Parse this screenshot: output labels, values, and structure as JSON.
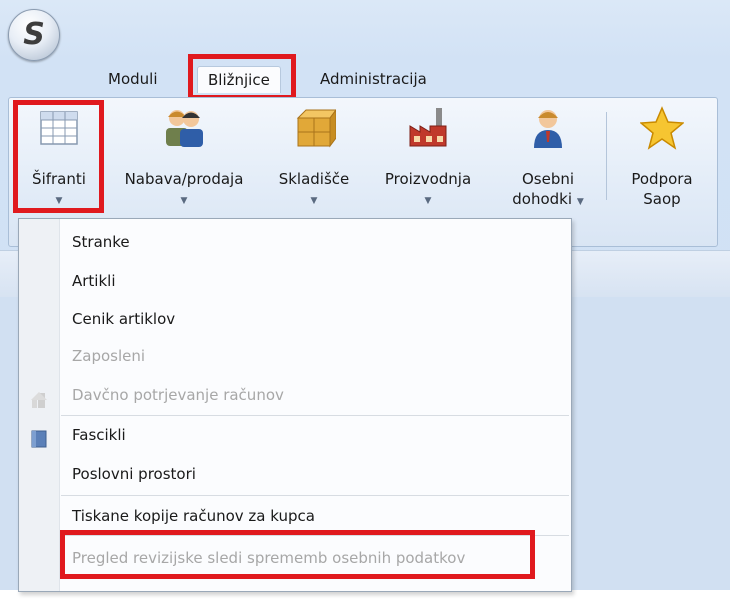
{
  "app": {
    "logo_glyph": "S"
  },
  "tabs": [
    {
      "label": "Moduli",
      "active": false
    },
    {
      "label": "Bližnjice",
      "active": true,
      "highlighted": true
    },
    {
      "label": "Administracija",
      "active": false
    }
  ],
  "ribbon": {
    "buttons": [
      {
        "line1": "Šifranti",
        "line2": "",
        "icon": "grid-table-icon",
        "has_dropdown": true,
        "highlighted": true
      },
      {
        "line1": "Nabava/prodaja",
        "line2": "",
        "icon": "people-icon",
        "has_dropdown": true
      },
      {
        "line1": "Skladišče",
        "line2": "",
        "icon": "boxes-icon",
        "has_dropdown": true
      },
      {
        "line1": "Proizvodnja",
        "line2": "",
        "icon": "factory-icon",
        "has_dropdown": true
      },
      {
        "line1": "Osebni",
        "line2": "dohodki",
        "icon": "person-icon",
        "has_dropdown": true
      },
      {
        "line1": "Podpora",
        "line2": "Saop",
        "icon": "star-icon",
        "has_dropdown": false
      }
    ]
  },
  "menu": {
    "items": [
      {
        "label": "Stranke",
        "enabled": true
      },
      {
        "label": "Artikli",
        "enabled": true
      },
      {
        "label": "Cenik artiklov",
        "enabled": true
      },
      {
        "label": "Zaposleni",
        "enabled": false
      },
      {
        "label": "Davčno potrjevanje računov",
        "enabled": false,
        "icon": "building-icon"
      },
      {
        "label": "Fascikli",
        "enabled": true,
        "icon": "folder-icon"
      },
      {
        "label": "Poslovni prostori",
        "enabled": true
      },
      {
        "label": "Tiskane kopije računov za kupca",
        "enabled": true
      },
      {
        "label": "Pregled revizijske sledi sprememb osebnih podatkov",
        "enabled": false,
        "highlighted": true
      }
    ]
  },
  "colors": {
    "highlight": "#e0191e",
    "accent": "#d2e2f5"
  }
}
